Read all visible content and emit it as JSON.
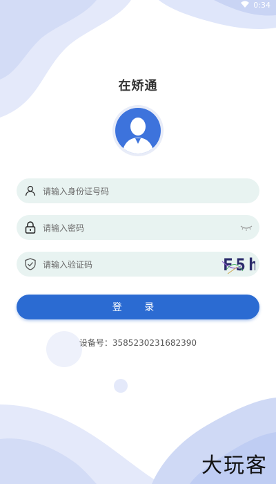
{
  "status": {
    "time": "0:34"
  },
  "app": {
    "title": "在矫通"
  },
  "form": {
    "id_placeholder": "请输入身份证号码",
    "password_placeholder": "请输入密码",
    "captcha_placeholder": "请输入验证码",
    "captcha_text": "F5h"
  },
  "login": {
    "label": "登 录"
  },
  "device": {
    "text": "设备号：3585230231682390"
  },
  "watermark": {
    "text": "大玩客"
  },
  "colors": {
    "primary": "#2b6bd2",
    "field_bg": "#e8f3f1",
    "blob": "#dbe3f8"
  },
  "icons": [
    "user-icon",
    "lock-icon",
    "shield-icon",
    "eye-closed-icon",
    "wifi-icon"
  ]
}
